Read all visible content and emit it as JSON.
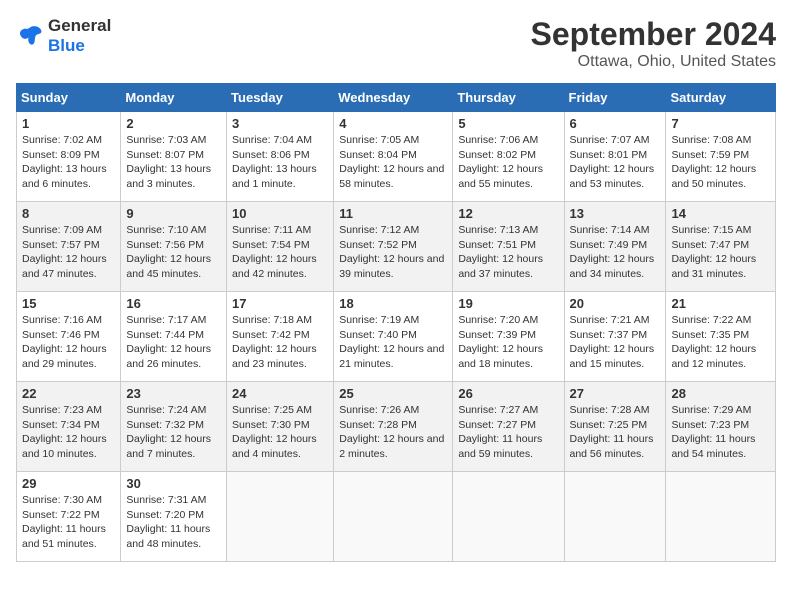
{
  "logo": {
    "line1": "General",
    "line2": "Blue"
  },
  "title": "September 2024",
  "location": "Ottawa, Ohio, United States",
  "weekdays": [
    "Sunday",
    "Monday",
    "Tuesday",
    "Wednesday",
    "Thursday",
    "Friday",
    "Saturday"
  ],
  "weeks": [
    [
      {
        "day": "1",
        "sunrise": "Sunrise: 7:02 AM",
        "sunset": "Sunset: 8:09 PM",
        "daylight": "Daylight: 13 hours and 6 minutes."
      },
      {
        "day": "2",
        "sunrise": "Sunrise: 7:03 AM",
        "sunset": "Sunset: 8:07 PM",
        "daylight": "Daylight: 13 hours and 3 minutes."
      },
      {
        "day": "3",
        "sunrise": "Sunrise: 7:04 AM",
        "sunset": "Sunset: 8:06 PM",
        "daylight": "Daylight: 13 hours and 1 minute."
      },
      {
        "day": "4",
        "sunrise": "Sunrise: 7:05 AM",
        "sunset": "Sunset: 8:04 PM",
        "daylight": "Daylight: 12 hours and 58 minutes."
      },
      {
        "day": "5",
        "sunrise": "Sunrise: 7:06 AM",
        "sunset": "Sunset: 8:02 PM",
        "daylight": "Daylight: 12 hours and 55 minutes."
      },
      {
        "day": "6",
        "sunrise": "Sunrise: 7:07 AM",
        "sunset": "Sunset: 8:01 PM",
        "daylight": "Daylight: 12 hours and 53 minutes."
      },
      {
        "day": "7",
        "sunrise": "Sunrise: 7:08 AM",
        "sunset": "Sunset: 7:59 PM",
        "daylight": "Daylight: 12 hours and 50 minutes."
      }
    ],
    [
      {
        "day": "8",
        "sunrise": "Sunrise: 7:09 AM",
        "sunset": "Sunset: 7:57 PM",
        "daylight": "Daylight: 12 hours and 47 minutes."
      },
      {
        "day": "9",
        "sunrise": "Sunrise: 7:10 AM",
        "sunset": "Sunset: 7:56 PM",
        "daylight": "Daylight: 12 hours and 45 minutes."
      },
      {
        "day": "10",
        "sunrise": "Sunrise: 7:11 AM",
        "sunset": "Sunset: 7:54 PM",
        "daylight": "Daylight: 12 hours and 42 minutes."
      },
      {
        "day": "11",
        "sunrise": "Sunrise: 7:12 AM",
        "sunset": "Sunset: 7:52 PM",
        "daylight": "Daylight: 12 hours and 39 minutes."
      },
      {
        "day": "12",
        "sunrise": "Sunrise: 7:13 AM",
        "sunset": "Sunset: 7:51 PM",
        "daylight": "Daylight: 12 hours and 37 minutes."
      },
      {
        "day": "13",
        "sunrise": "Sunrise: 7:14 AM",
        "sunset": "Sunset: 7:49 PM",
        "daylight": "Daylight: 12 hours and 34 minutes."
      },
      {
        "day": "14",
        "sunrise": "Sunrise: 7:15 AM",
        "sunset": "Sunset: 7:47 PM",
        "daylight": "Daylight: 12 hours and 31 minutes."
      }
    ],
    [
      {
        "day": "15",
        "sunrise": "Sunrise: 7:16 AM",
        "sunset": "Sunset: 7:46 PM",
        "daylight": "Daylight: 12 hours and 29 minutes."
      },
      {
        "day": "16",
        "sunrise": "Sunrise: 7:17 AM",
        "sunset": "Sunset: 7:44 PM",
        "daylight": "Daylight: 12 hours and 26 minutes."
      },
      {
        "day": "17",
        "sunrise": "Sunrise: 7:18 AM",
        "sunset": "Sunset: 7:42 PM",
        "daylight": "Daylight: 12 hours and 23 minutes."
      },
      {
        "day": "18",
        "sunrise": "Sunrise: 7:19 AM",
        "sunset": "Sunset: 7:40 PM",
        "daylight": "Daylight: 12 hours and 21 minutes."
      },
      {
        "day": "19",
        "sunrise": "Sunrise: 7:20 AM",
        "sunset": "Sunset: 7:39 PM",
        "daylight": "Daylight: 12 hours and 18 minutes."
      },
      {
        "day": "20",
        "sunrise": "Sunrise: 7:21 AM",
        "sunset": "Sunset: 7:37 PM",
        "daylight": "Daylight: 12 hours and 15 minutes."
      },
      {
        "day": "21",
        "sunrise": "Sunrise: 7:22 AM",
        "sunset": "Sunset: 7:35 PM",
        "daylight": "Daylight: 12 hours and 12 minutes."
      }
    ],
    [
      {
        "day": "22",
        "sunrise": "Sunrise: 7:23 AM",
        "sunset": "Sunset: 7:34 PM",
        "daylight": "Daylight: 12 hours and 10 minutes."
      },
      {
        "day": "23",
        "sunrise": "Sunrise: 7:24 AM",
        "sunset": "Sunset: 7:32 PM",
        "daylight": "Daylight: 12 hours and 7 minutes."
      },
      {
        "day": "24",
        "sunrise": "Sunrise: 7:25 AM",
        "sunset": "Sunset: 7:30 PM",
        "daylight": "Daylight: 12 hours and 4 minutes."
      },
      {
        "day": "25",
        "sunrise": "Sunrise: 7:26 AM",
        "sunset": "Sunset: 7:28 PM",
        "daylight": "Daylight: 12 hours and 2 minutes."
      },
      {
        "day": "26",
        "sunrise": "Sunrise: 7:27 AM",
        "sunset": "Sunset: 7:27 PM",
        "daylight": "Daylight: 11 hours and 59 minutes."
      },
      {
        "day": "27",
        "sunrise": "Sunrise: 7:28 AM",
        "sunset": "Sunset: 7:25 PM",
        "daylight": "Daylight: 11 hours and 56 minutes."
      },
      {
        "day": "28",
        "sunrise": "Sunrise: 7:29 AM",
        "sunset": "Sunset: 7:23 PM",
        "daylight": "Daylight: 11 hours and 54 minutes."
      }
    ],
    [
      {
        "day": "29",
        "sunrise": "Sunrise: 7:30 AM",
        "sunset": "Sunset: 7:22 PM",
        "daylight": "Daylight: 11 hours and 51 minutes."
      },
      {
        "day": "30",
        "sunrise": "Sunrise: 7:31 AM",
        "sunset": "Sunset: 7:20 PM",
        "daylight": "Daylight: 11 hours and 48 minutes."
      },
      null,
      null,
      null,
      null,
      null
    ]
  ]
}
